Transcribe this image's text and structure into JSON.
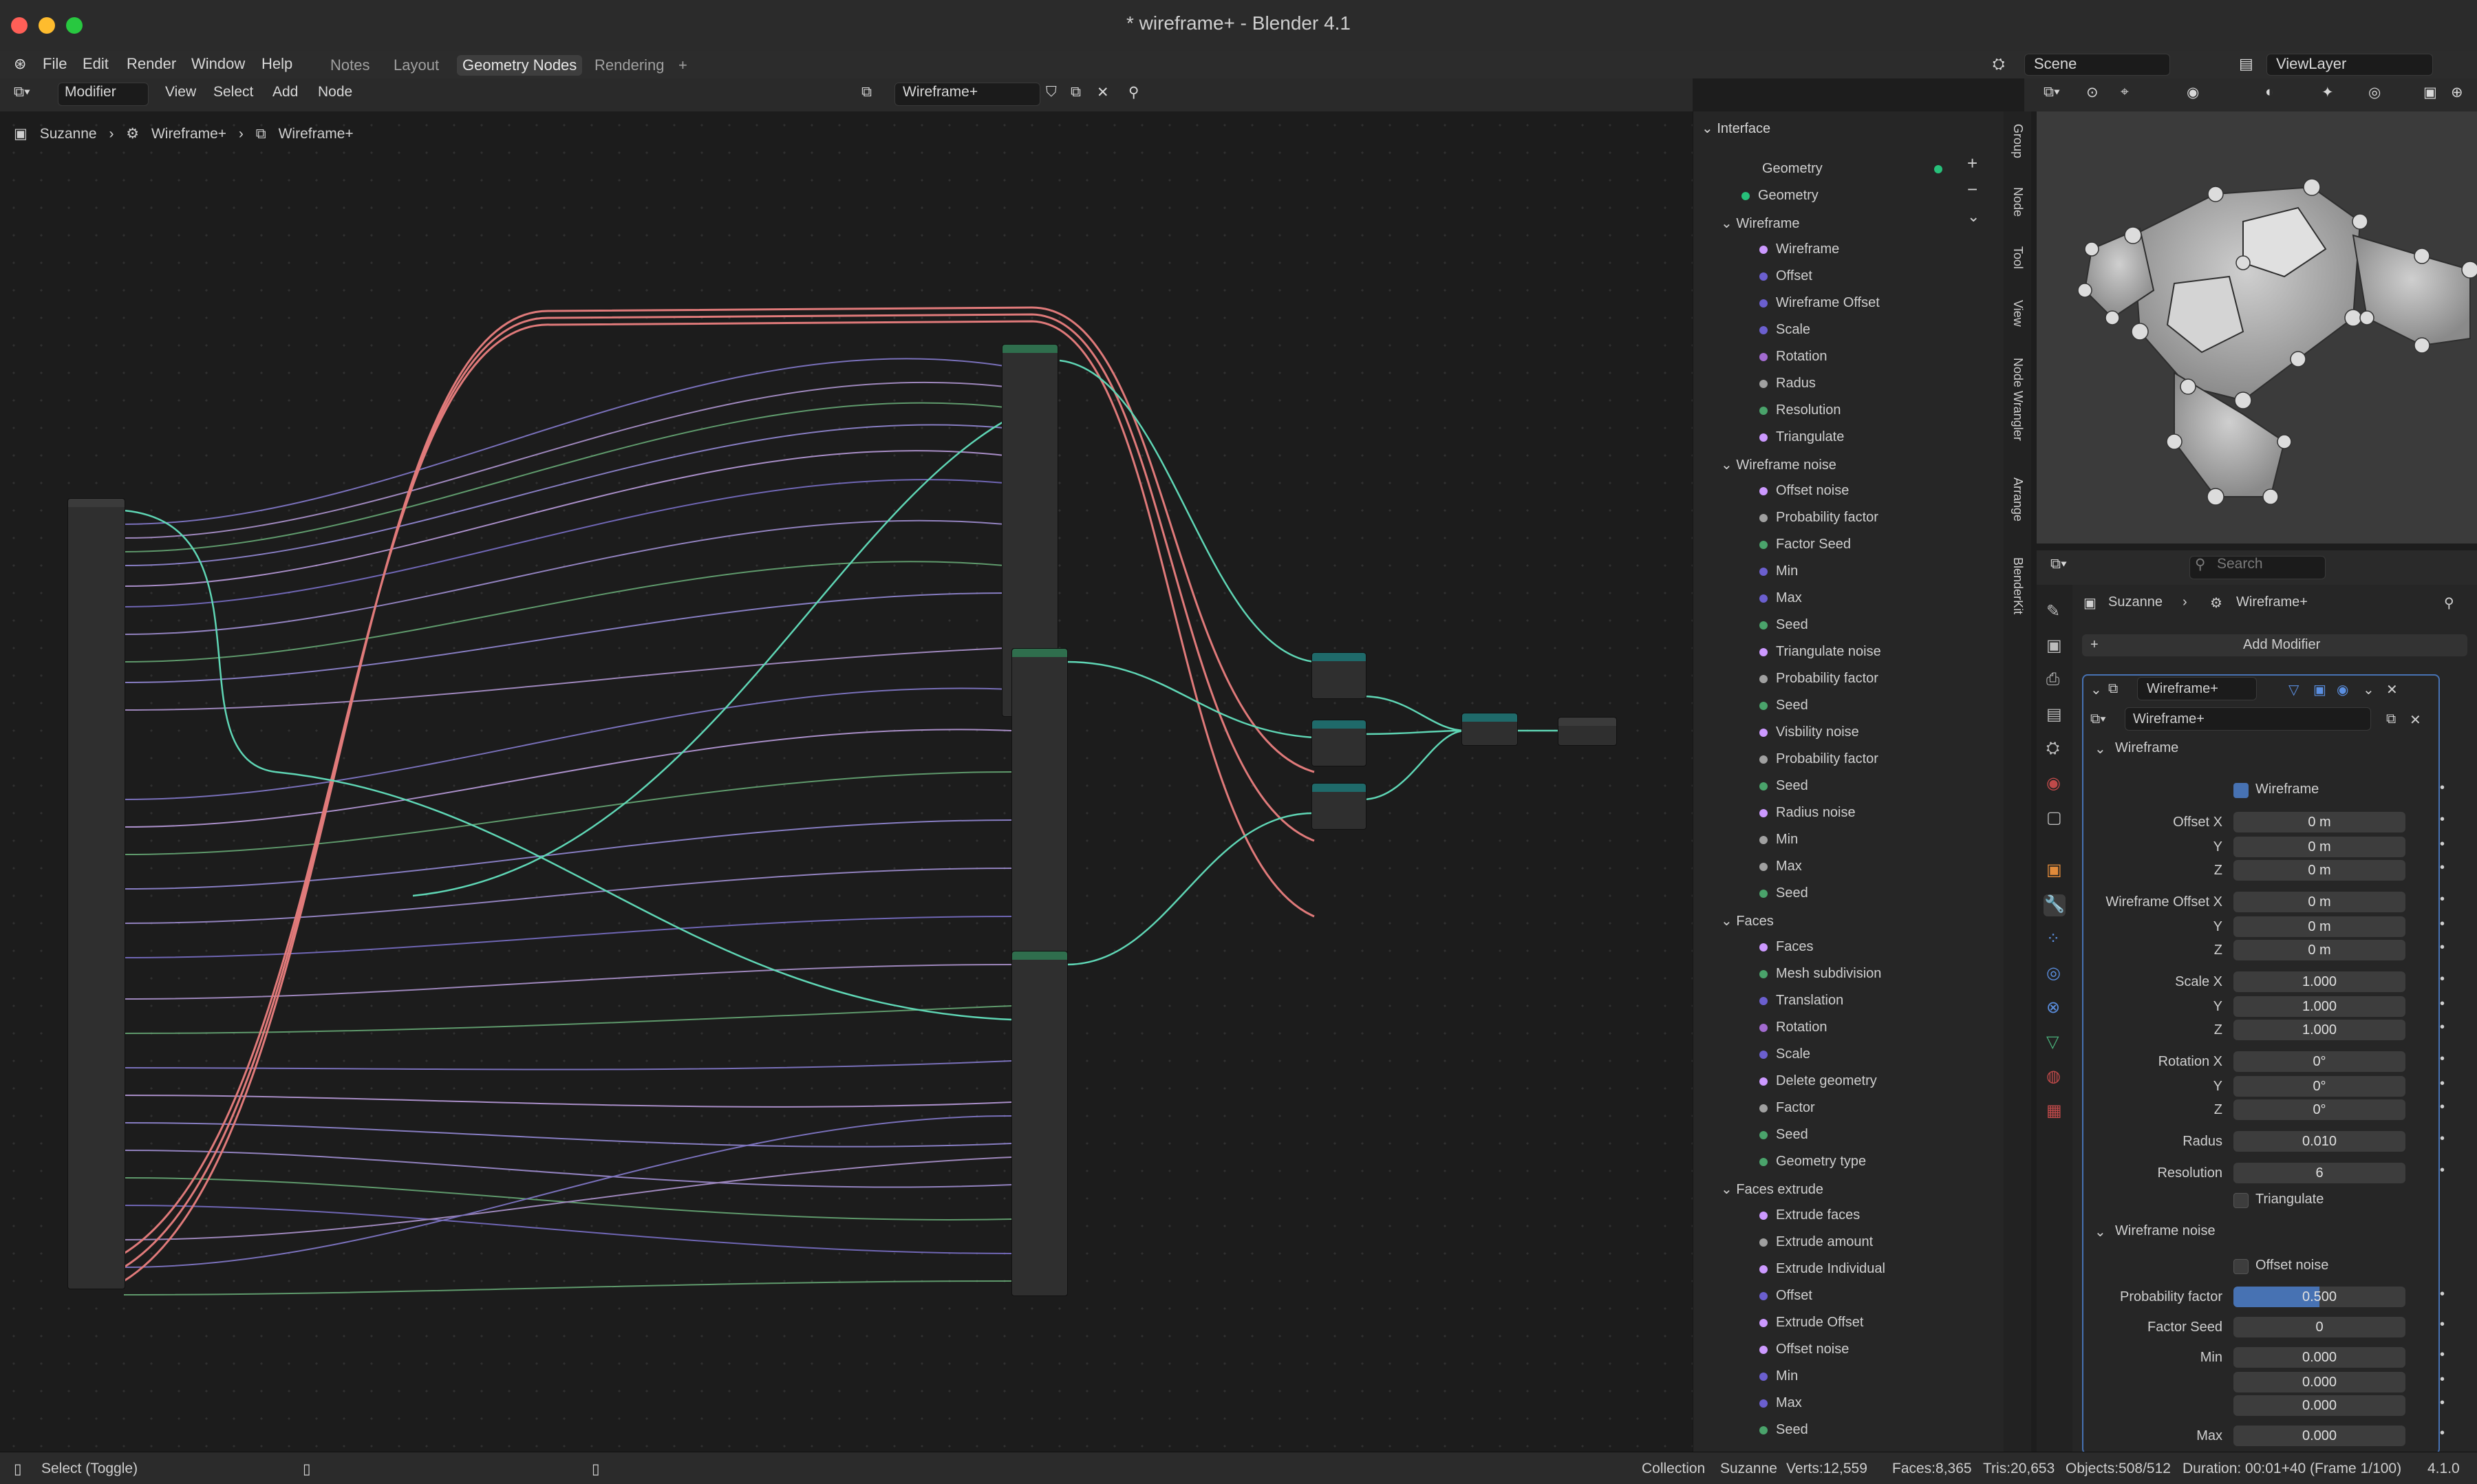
{
  "window": {
    "title": "* wireframe+ - Blender 4.1"
  },
  "menu": [
    "File",
    "Edit",
    "Render",
    "Window",
    "Help"
  ],
  "workspaces": [
    {
      "label": "Notes",
      "active": false
    },
    {
      "label": "Layout",
      "active": false
    },
    {
      "label": "Geometry Nodes",
      "active": true
    },
    {
      "label": "Rendering",
      "active": false
    }
  ],
  "scene": {
    "label": "Scene"
  },
  "viewlayer": {
    "label": "ViewLayer"
  },
  "node_header": {
    "editor_mode": "Modifier",
    "menus": [
      "View",
      "Select",
      "Add",
      "Node"
    ],
    "node_group": "Wireframe+"
  },
  "breadcrumb": [
    "Suzanne",
    "Wireframe+",
    "Wireframe+"
  ],
  "interface": {
    "title": "Interface",
    "outputs": [
      {
        "label": "Geometry",
        "color": "#27c07a"
      }
    ],
    "inputs": [
      {
        "label": "Geometry",
        "color": "#27c07a"
      }
    ],
    "panels": [
      {
        "title": "Wireframe",
        "items": [
          {
            "label": "Wireframe",
            "color": "#cc99ff"
          },
          {
            "label": "Offset",
            "color": "#6b5fcf"
          },
          {
            "label": "Wireframe Offset",
            "color": "#6b5fcf"
          },
          {
            "label": "Scale",
            "color": "#6b5fcf"
          },
          {
            "label": "Rotation",
            "color": "#a26bd0"
          },
          {
            "label": "Radus",
            "color": "#a0a0a0"
          },
          {
            "label": "Resolution",
            "color": "#4aa36b"
          },
          {
            "label": "Triangulate",
            "color": "#cc99ff"
          }
        ]
      },
      {
        "title": "Wireframe noise",
        "items": [
          {
            "label": "Offset noise",
            "color": "#cc99ff"
          },
          {
            "label": "Probability factor",
            "color": "#a0a0a0"
          },
          {
            "label": "Factor Seed",
            "color": "#4aa36b"
          },
          {
            "label": "Min",
            "color": "#6b5fcf"
          },
          {
            "label": "Max",
            "color": "#6b5fcf"
          },
          {
            "label": "Seed",
            "color": "#4aa36b"
          },
          {
            "label": "Triangulate noise",
            "color": "#cc99ff"
          },
          {
            "label": "Probability factor",
            "color": "#a0a0a0"
          },
          {
            "label": "Seed",
            "color": "#4aa36b"
          },
          {
            "label": "Visbility noise",
            "color": "#cc99ff"
          },
          {
            "label": "Probability factor",
            "color": "#a0a0a0"
          },
          {
            "label": "Seed",
            "color": "#4aa36b"
          },
          {
            "label": "Radius noise",
            "color": "#cc99ff"
          },
          {
            "label": "Min",
            "color": "#a0a0a0"
          },
          {
            "label": "Max",
            "color": "#a0a0a0"
          },
          {
            "label": "Seed",
            "color": "#4aa36b"
          }
        ]
      },
      {
        "title": "Faces",
        "items": [
          {
            "label": "Faces",
            "color": "#cc99ff"
          },
          {
            "label": "Mesh subdivision",
            "color": "#4aa36b"
          },
          {
            "label": "Translation",
            "color": "#6b5fcf"
          },
          {
            "label": "Rotation",
            "color": "#a26bd0"
          },
          {
            "label": "Scale",
            "color": "#6b5fcf"
          },
          {
            "label": "Delete geometry",
            "color": "#cc99ff"
          },
          {
            "label": "Factor",
            "color": "#a0a0a0"
          },
          {
            "label": "Seed",
            "color": "#4aa36b"
          },
          {
            "label": "Geometry type",
            "color": "#4aa36b"
          }
        ]
      },
      {
        "title": "Faces extrude",
        "items": [
          {
            "label": "Extrude faces",
            "color": "#cc99ff"
          },
          {
            "label": "Extrude amount",
            "color": "#a0a0a0"
          },
          {
            "label": "Extrude Individual",
            "color": "#cc99ff"
          },
          {
            "label": "Offset",
            "color": "#6b5fcf"
          },
          {
            "label": "Extrude Offset",
            "color": "#cc99ff"
          },
          {
            "label": "Offset noise",
            "color": "#cc99ff"
          },
          {
            "label": "Min",
            "color": "#6b5fcf"
          },
          {
            "label": "Max",
            "color": "#6b5fcf"
          },
          {
            "label": "Seed",
            "color": "#4aa36b"
          }
        ]
      }
    ]
  },
  "side_tabs": [
    "Group",
    "Node",
    "Tool",
    "View",
    "Node Wrangler",
    "Arrange",
    "BlenderKit"
  ],
  "properties": {
    "search_placeholder": "Search",
    "object": "Suzanne",
    "modifier_name": "Wireframe+",
    "add_modifier": "Add Modifier",
    "modifier_title": "Wireframe+",
    "node_group": "Wireframe+",
    "wireframe_panel": "Wireframe",
    "wireframe_checkbox": "Wireframe",
    "fields": [
      {
        "label": "Offset X",
        "value": "0 m"
      },
      {
        "label": "Y",
        "value": "0 m"
      },
      {
        "label": "Z",
        "value": "0 m"
      },
      {
        "label": "Wireframe Offset X",
        "value": "0 m"
      },
      {
        "label": "Y",
        "value": "0 m"
      },
      {
        "label": "Z",
        "value": "0 m"
      },
      {
        "label": "Scale X",
        "value": "1.000"
      },
      {
        "label": "Y",
        "value": "1.000"
      },
      {
        "label": "Z",
        "value": "1.000"
      },
      {
        "label": "Rotation X",
        "value": "0°"
      },
      {
        "label": "Y",
        "value": "0°"
      },
      {
        "label": "Z",
        "value": "0°"
      },
      {
        "label": "Radus",
        "value": "0.010"
      },
      {
        "label": "Resolution",
        "value": "6"
      }
    ],
    "triangulate": "Triangulate",
    "noise_panel": "Wireframe noise",
    "offset_noise": "Offset noise",
    "noise_fields": [
      {
        "label": "Probability factor",
        "value": "0.500"
      },
      {
        "label": "Factor Seed",
        "value": "0"
      },
      {
        "label": "Min",
        "value": "0.000"
      },
      {
        "label": "",
        "value": "0.000"
      },
      {
        "label": "",
        "value": "0.000"
      },
      {
        "label": "Max",
        "value": "0.000"
      }
    ],
    "probability_fill": 0.5
  },
  "status": {
    "left": "Select (Toggle)",
    "collection": "Collection",
    "object": "Suzanne",
    "verts": "Verts:12,559",
    "faces": "Faces:8,365",
    "tris": "Tris:20,653",
    "objects": "Objects:508/512",
    "duration": "Duration: 00:01+40 (Frame 1/100)",
    "version": "4.1.0"
  },
  "colors": {
    "accent": "#4772b3",
    "geometry_socket": "#27c07a",
    "wire_red": "#e07a7a"
  }
}
